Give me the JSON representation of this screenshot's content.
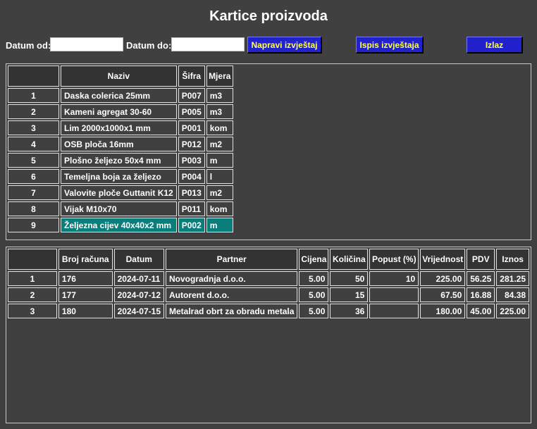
{
  "title": "Kartice proizvoda",
  "toolbar": {
    "date_from_label": "Datum od:",
    "date_from_value": "",
    "date_to_label": "Datum do:",
    "date_to_value": "",
    "make_report_label": "Napravi izvještaj",
    "print_report_label": "Ispis izvještaja",
    "exit_label": "Izlaz"
  },
  "products": {
    "headers": [
      "",
      "Naziv",
      "Šifra",
      "Mjera"
    ],
    "rows": [
      {
        "n": "1",
        "naziv": "Daska colerica 25mm",
        "sifra": "P007",
        "mjera": "m3"
      },
      {
        "n": "2",
        "naziv": "Kameni agregat 30-60",
        "sifra": "P005",
        "mjera": "m3"
      },
      {
        "n": "3",
        "naziv": "Lim 2000x1000x1 mm",
        "sifra": "P001",
        "mjera": "kom"
      },
      {
        "n": "4",
        "naziv": "OSB ploča 16mm",
        "sifra": "P012",
        "mjera": "m2"
      },
      {
        "n": "5",
        "naziv": "Plošno željezo 50x4 mm",
        "sifra": "P003",
        "mjera": "m"
      },
      {
        "n": "6",
        "naziv": "Temeljna boja za željezo",
        "sifra": "P004",
        "mjera": "l"
      },
      {
        "n": "7",
        "naziv": "Valovite ploče Guttanit K12",
        "sifra": "P013",
        "mjera": "m2"
      },
      {
        "n": "8",
        "naziv": "Vijak M10x70",
        "sifra": "P011",
        "mjera": "kom"
      },
      {
        "n": "9",
        "naziv": "Željezna cijev 40x40x2 mm",
        "sifra": "P002",
        "mjera": "m"
      }
    ],
    "selected_row": 9
  },
  "invoices": {
    "headers": [
      "",
      "Broj računa",
      "Datum",
      "Partner",
      "Cijena",
      "Količina",
      "Popust (%)",
      "Vrijednost",
      "PDV",
      "Iznos"
    ],
    "rows": [
      {
        "n": "1",
        "broj": "176",
        "datum": "2024-07-11",
        "partner": "Novogradnja d.o.o.",
        "cijena": "5.00",
        "kolicina": "50",
        "popust": "10",
        "vrijednost": "225.00",
        "pdv": "56.25",
        "iznos": "281.25"
      },
      {
        "n": "2",
        "broj": "177",
        "datum": "2024-07-12",
        "partner": "Autorent d.o.o.",
        "cijena": "5.00",
        "kolicina": "15",
        "popust": "",
        "vrijednost": "67.50",
        "pdv": "16.88",
        "iznos": "84.38"
      },
      {
        "n": "3",
        "broj": "180",
        "datum": "2024-07-15",
        "partner": "Metalrad obrt za obradu metala",
        "cijena": "5.00",
        "kolicina": "36",
        "popust": "",
        "vrijednost": "180.00",
        "pdv": "45.00",
        "iznos": "225.00"
      }
    ]
  }
}
